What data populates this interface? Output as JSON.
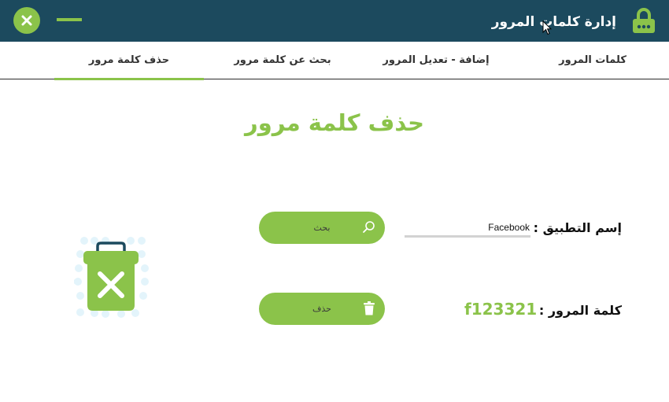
{
  "window": {
    "title": "إدارة كلمات المرور",
    "close_icon": "close-icon",
    "minimize_icon": "minimize-icon",
    "app_icon": "lock-icon",
    "accent_color": "#8bc34a",
    "titlebar_color": "#1c4a5e"
  },
  "tabs": [
    {
      "label": "كلمات المرور",
      "active": false
    },
    {
      "label": "إضافة - تعديل المرور",
      "active": false
    },
    {
      "label": "بحث عن كلمة مرور",
      "active": false
    },
    {
      "label": "حذف كلمة مرور",
      "active": true
    }
  ],
  "main": {
    "title": "حذف كلمة مرور",
    "app_name": {
      "label": "إسم التطبيق :",
      "value": "Facebook"
    },
    "password": {
      "label": "كلمة المرور :",
      "value": "f123321"
    },
    "search_button": {
      "label": "بحث",
      "icon": "search-icon"
    },
    "delete_button": {
      "label": "حذف",
      "icon": "trash-icon"
    },
    "illustration_icon": "trash-delete-icon"
  }
}
